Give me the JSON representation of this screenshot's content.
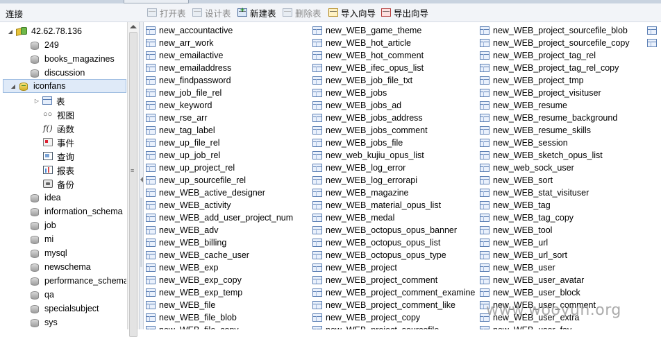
{
  "left_panel": {
    "title": "连接"
  },
  "toolbar": [
    {
      "label": "打开表",
      "enabled": false,
      "icon": "open-table-icon"
    },
    {
      "label": "设计表",
      "enabled": false,
      "icon": "design-table-icon"
    },
    {
      "label": "新建表",
      "enabled": true,
      "icon": "new-table-icon"
    },
    {
      "label": "删除表",
      "enabled": false,
      "icon": "delete-table-icon"
    },
    {
      "label": "导入向导",
      "enabled": true,
      "icon": "import-wizard-icon"
    },
    {
      "label": "导出向导",
      "enabled": true,
      "icon": "export-wizard-icon"
    }
  ],
  "tree": {
    "server": "42.62.78.136",
    "databases_before": [
      "249",
      "books_magazines",
      "discussion"
    ],
    "selected_db": "iconfans",
    "db_children": [
      {
        "label": "表",
        "icon": "table-icon"
      },
      {
        "label": "视图",
        "icon": "view-glasses-icon"
      },
      {
        "label": "函数",
        "icon": "function-icon"
      },
      {
        "label": "事件",
        "icon": "event-icon"
      },
      {
        "label": "查询",
        "icon": "query-icon"
      },
      {
        "label": "报表",
        "icon": "report-icon"
      },
      {
        "label": "备份",
        "icon": "backup-icon"
      }
    ],
    "databases_after": [
      "idea",
      "information_schema",
      "job",
      "mi",
      "mysql",
      "newschema",
      "performance_schema",
      "qa",
      "specialsubject",
      "sys"
    ]
  },
  "tables": {
    "col1": [
      "new_accountactive",
      "new_arr_work",
      "new_emailactive",
      "new_emailaddress",
      "new_findpassword",
      "new_job_file_rel",
      "new_keyword",
      "new_rse_arr",
      "new_tag_label",
      "new_up_file_rel",
      "new_up_job_rel",
      "new_up_project_rel",
      "new_up_sourcefile_rel",
      "new_WEB_active_designer",
      "new_WEB_activity",
      "new_WEB_add_user_project_num",
      "new_WEB_adv",
      "new_WEB_billing",
      "new_WEB_cache_user",
      "new_WEB_exp",
      "new_WEB_exp_copy",
      "new_WEB_exp_temp",
      "new_WEB_file",
      "new_WEB_file_blob",
      "new_WEB_file_copy"
    ],
    "col2": [
      "new_WEB_game_theme",
      "new_WEB_hot_article",
      "new_WEB_hot_comment",
      "new_WEB_ifec_opus_list",
      "new_WEB_job_file_txt",
      "new_WEB_jobs",
      "new_WEB_jobs_ad",
      "new_WEB_jobs_address",
      "new_WEB_jobs_comment",
      "new_WEB_jobs_file",
      "new_web_kujiu_opus_list",
      "new_WEB_log_error",
      "new_WEB_log_errorapi",
      "new_WEB_magazine",
      "new_WEB_material_opus_list",
      "new_WEB_medal",
      "new_WEB_octopus_opus_banner",
      "new_WEB_octopus_opus_list",
      "new_WEB_octopus_opus_type",
      "new_WEB_project",
      "new_WEB_project_comment",
      "new_WEB_project_comment_examine",
      "new_WEB_project_comment_like",
      "new_WEB_project_copy",
      "new_WEB_project_sourcefile"
    ],
    "col3": [
      "new_WEB_project_sourcefile_blob",
      "new_WEB_project_sourcefile_copy",
      "new_WEB_project_tag_rel",
      "new_WEB_project_tag_rel_copy",
      "new_WEB_project_tmp",
      "new_WEB_project_visituser",
      "new_WEB_resume",
      "new_WEB_resume_background",
      "new_WEB_resume_skills",
      "new_WEB_session",
      "new_WEB_sketch_opus_list",
      "new_web_sock_user",
      "new_WEB_sort",
      "new_WEB_stat_visituser",
      "new_WEB_tag",
      "new_WEB_tag_copy",
      "new_WEB_tool",
      "new_WEB_url",
      "new_WEB_url_sort",
      "new_WEB_user",
      "new_WEB_user_avatar",
      "new_WEB_user_block",
      "new_WEB_user_comment",
      "new_WEB_user_extra",
      "new_WEB_user_fav"
    ]
  },
  "watermark": "www.wooyun.org"
}
